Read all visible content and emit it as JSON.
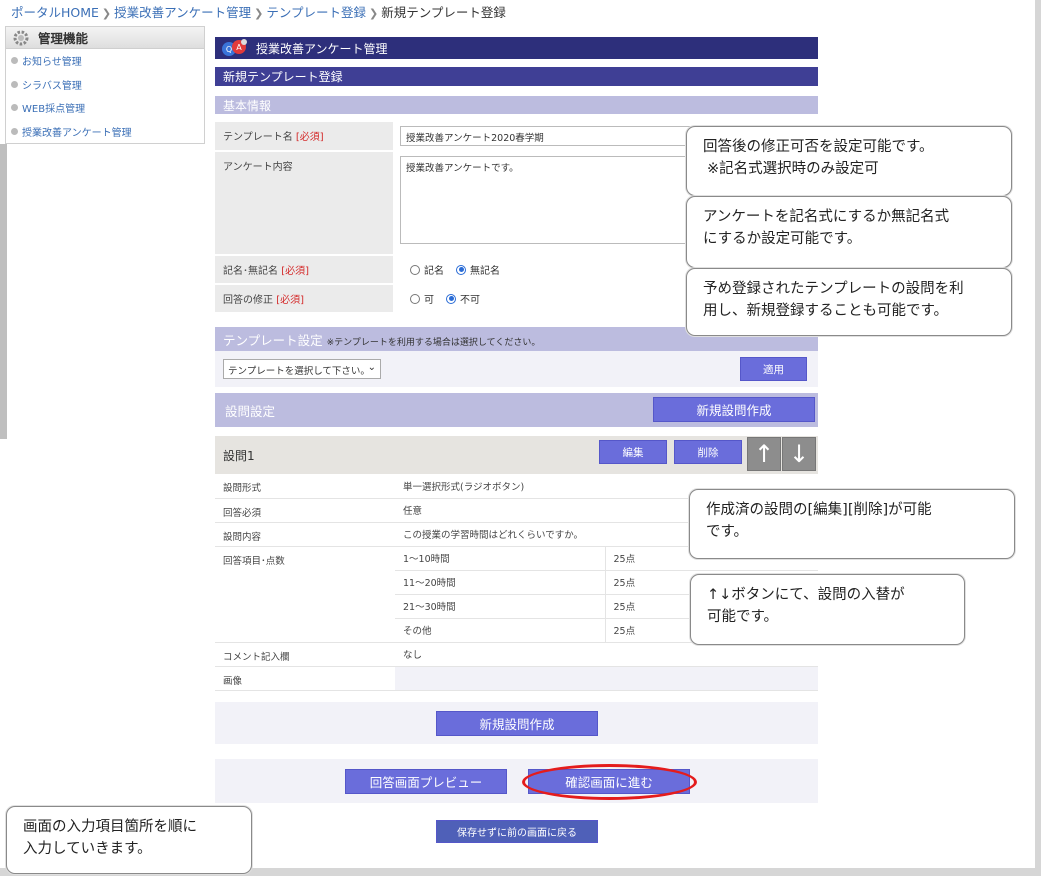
{
  "breadcrumb": [
    "ポータルHOME",
    "授業改善アンケート管理",
    "テンプレート登録",
    "新規テンプレート登録"
  ],
  "sidebar": {
    "title": "管理機能",
    "items": [
      {
        "label": "お知らせ管理"
      },
      {
        "label": "シラバス管理"
      },
      {
        "label": "WEB採点管理"
      },
      {
        "label": "授業改善アンケート管理"
      }
    ]
  },
  "header": {
    "title": "授業改善アンケート管理",
    "subtitle": "新規テンプレート登録",
    "section": "基本情報"
  },
  "form": {
    "template_name_label": "テンプレート名",
    "required": "[必須]",
    "template_name_value": "授業改善アンケート2020春学期",
    "content_label": "アンケート内容",
    "content_value": "授業改善アンケートです。",
    "named_label": "記名･無記名",
    "named_options": [
      "記名",
      "無記名"
    ],
    "edit_label": "回答の修正",
    "edit_options": [
      "可",
      "不可"
    ]
  },
  "template_setting": {
    "title": "テンプレート設定",
    "note": "※テンプレートを利用する場合は選択してください。",
    "select_value": "テンプレートを選択して下さい。",
    "apply_label": "適用"
  },
  "question_setting": {
    "title": "設問設定",
    "new_label": "新規設問作成"
  },
  "question1": {
    "title": "設問1",
    "edit_label": "編集",
    "delete_label": "削除",
    "up": "↑",
    "down": "↓",
    "rows": {
      "type_label": "設問形式",
      "type_value": "単一選択形式(ラジオボタン)",
      "required_label": "回答必須",
      "required_value": "任意",
      "content_label": "設問内容",
      "content_value": "この授業の学習時間はどれくらいですか。",
      "items_label": "回答項目･点数",
      "items": [
        {
          "answer": "1～10時間",
          "points": "25点"
        },
        {
          "answer": "11～20時間",
          "points": "25点"
        },
        {
          "answer": "21～30時間",
          "points": "25点"
        },
        {
          "answer": "その他",
          "points": "25点"
        }
      ],
      "comment_label": "コメント記入欄",
      "comment_value": "なし",
      "image_label": "画像"
    }
  },
  "footer": {
    "new_question_label": "新規設問作成",
    "preview_label": "回答画面プレビュー",
    "confirm_label": "確認画面に進む",
    "back_label": "保存せずに前の画面に戻る"
  },
  "callouts": {
    "c1_line1": "回答後の修正可否を設定可能です。",
    "c1_line2": "※記名式選択時のみ設定可",
    "c2_line1": "アンケートを記名式にするか無記名式",
    "c2_line2": "にするか設定可能です。",
    "c3_line1": "予め登録されたテンプレートの設問を利",
    "c3_line2": "用し、新規登録することも可能です。",
    "c4_line1": "作成済の設問の[編集][削除]が可能",
    "c4_line2": "です。",
    "c5_line1": "↑↓ボタンにて、設問の入替が",
    "c5_line2": "可能です。",
    "c6_line1": "画面の入力項目箇所を順に",
    "c6_line2": "入力していきます。"
  },
  "colors": {
    "navy": "#2d2f7b",
    "accent": "#6a6ddb",
    "highlight": "#e41c1c"
  }
}
